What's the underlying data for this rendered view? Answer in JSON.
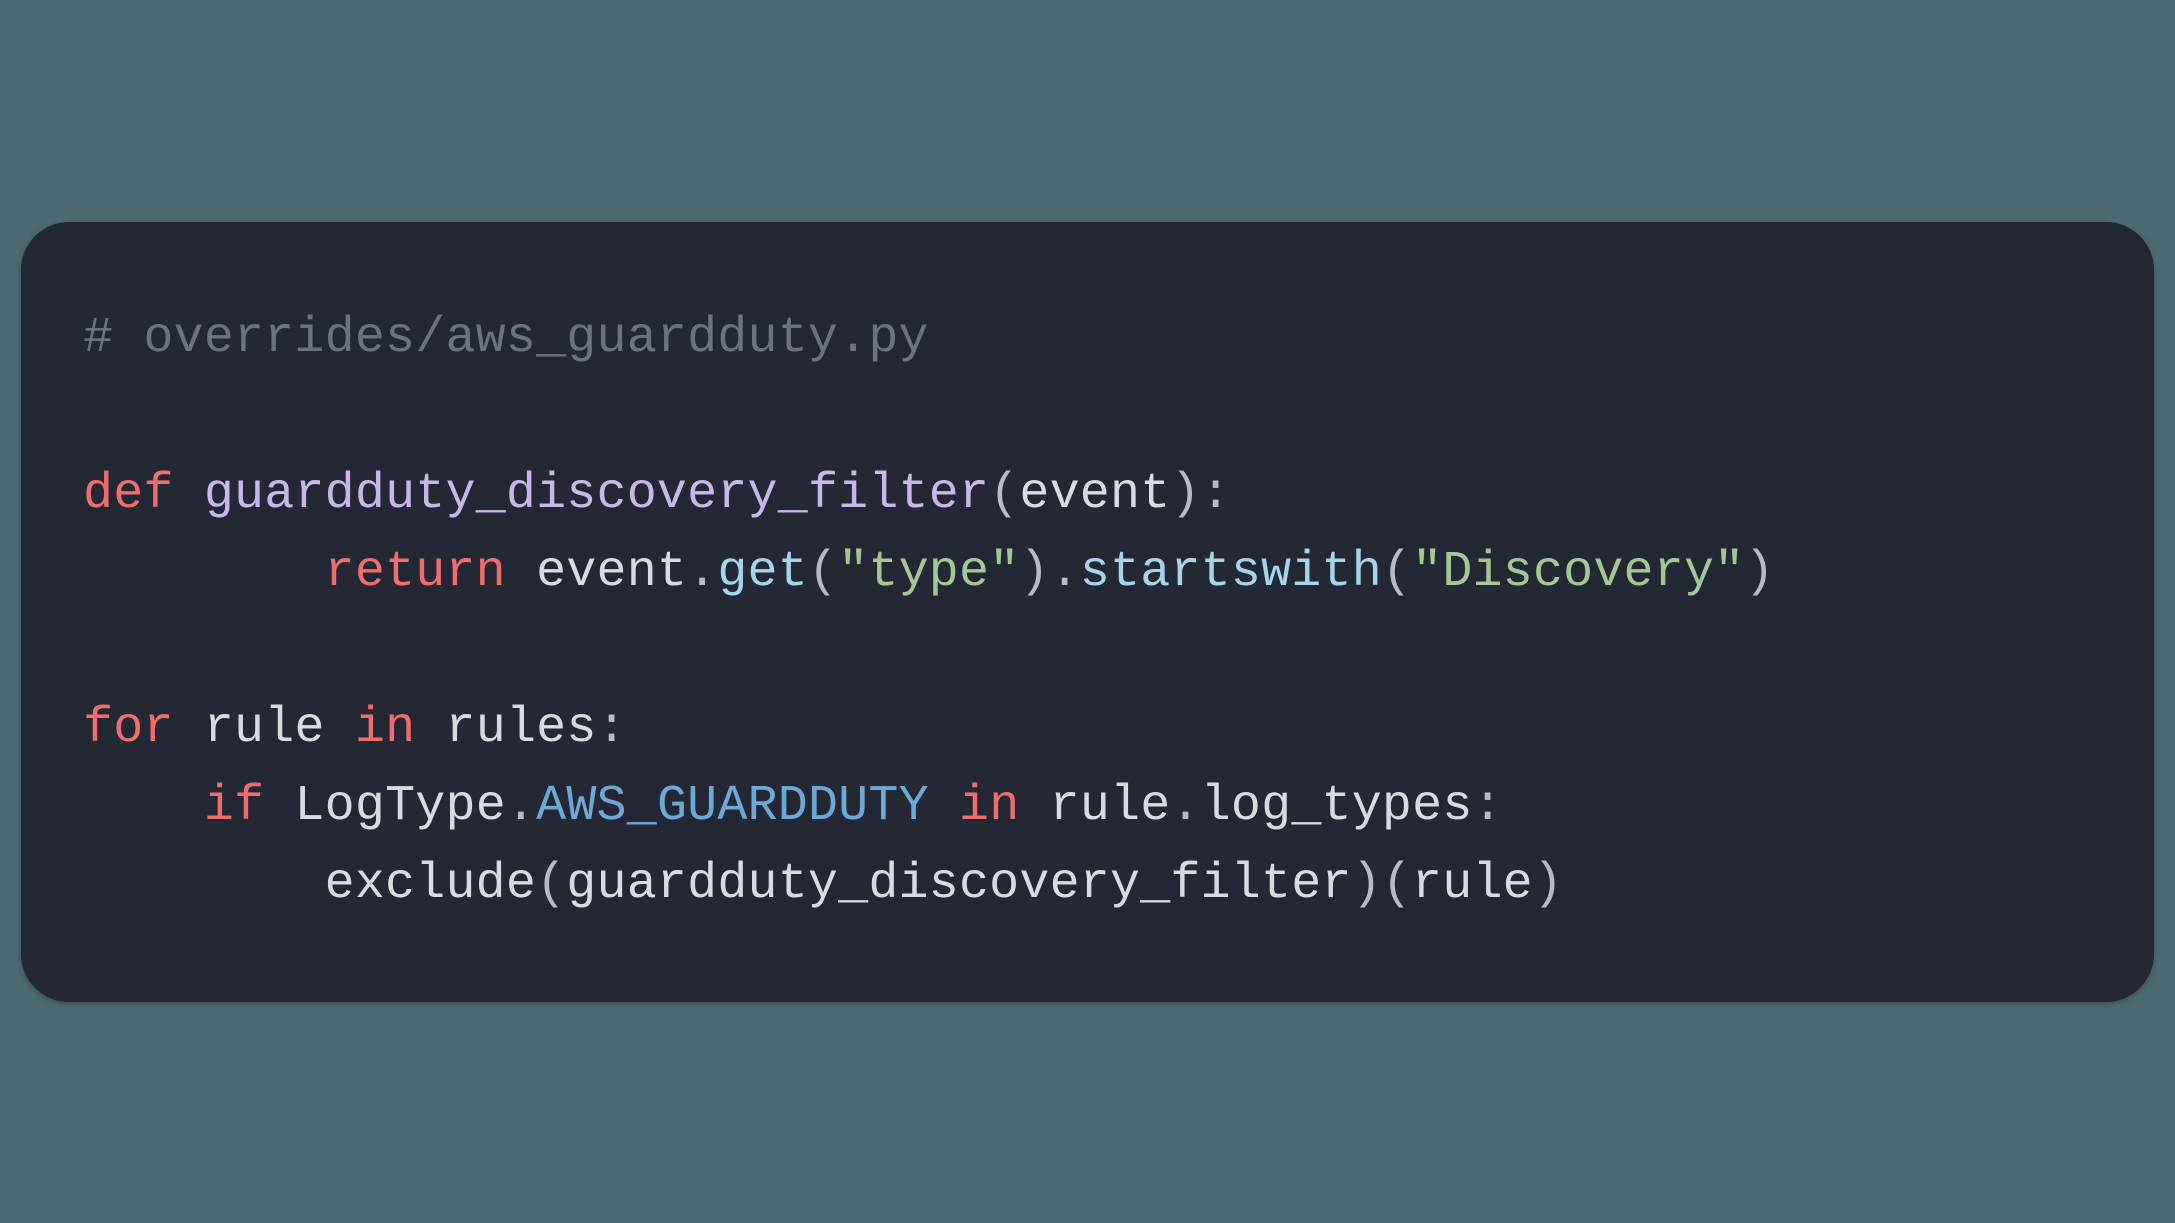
{
  "code": {
    "lines": [
      {
        "tokens": [
          {
            "cls": "tok-comment",
            "text": "# overrides/aws_guardduty.py"
          }
        ]
      },
      {
        "tokens": [
          {
            "cls": "",
            "text": " "
          }
        ]
      },
      {
        "tokens": [
          {
            "cls": "tok-keyword",
            "text": "def"
          },
          {
            "cls": "",
            "text": " "
          },
          {
            "cls": "tok-funcname",
            "text": "guardduty_discovery_filter"
          },
          {
            "cls": "tok-punct",
            "text": "("
          },
          {
            "cls": "tok-ident",
            "text": "event"
          },
          {
            "cls": "tok-punct",
            "text": "):"
          }
        ]
      },
      {
        "tokens": [
          {
            "cls": "",
            "text": "        "
          },
          {
            "cls": "tok-keyword",
            "text": "return"
          },
          {
            "cls": "",
            "text": " "
          },
          {
            "cls": "tok-ident",
            "text": "event"
          },
          {
            "cls": "tok-punct",
            "text": "."
          },
          {
            "cls": "tok-method",
            "text": "get"
          },
          {
            "cls": "tok-punct",
            "text": "("
          },
          {
            "cls": "tok-string",
            "text": "\"type\""
          },
          {
            "cls": "tok-punct",
            "text": ")."
          },
          {
            "cls": "tok-method",
            "text": "startswith"
          },
          {
            "cls": "tok-punct",
            "text": "("
          },
          {
            "cls": "tok-string",
            "text": "\"Discovery\""
          },
          {
            "cls": "tok-punct",
            "text": ")"
          }
        ]
      },
      {
        "tokens": [
          {
            "cls": "",
            "text": " "
          }
        ]
      },
      {
        "tokens": [
          {
            "cls": "tok-keyword",
            "text": "for"
          },
          {
            "cls": "",
            "text": " "
          },
          {
            "cls": "tok-ident",
            "text": "rule"
          },
          {
            "cls": "",
            "text": " "
          },
          {
            "cls": "tok-keyword",
            "text": "in"
          },
          {
            "cls": "",
            "text": " "
          },
          {
            "cls": "tok-ident",
            "text": "rules"
          },
          {
            "cls": "tok-punct",
            "text": ":"
          }
        ]
      },
      {
        "tokens": [
          {
            "cls": "",
            "text": "    "
          },
          {
            "cls": "tok-keyword",
            "text": "if"
          },
          {
            "cls": "",
            "text": " "
          },
          {
            "cls": "tok-ident",
            "text": "LogType"
          },
          {
            "cls": "tok-punct",
            "text": "."
          },
          {
            "cls": "tok-const",
            "text": "AWS_GUARDDUTY"
          },
          {
            "cls": "",
            "text": " "
          },
          {
            "cls": "tok-keyword",
            "text": "in"
          },
          {
            "cls": "",
            "text": " "
          },
          {
            "cls": "tok-ident",
            "text": "rule"
          },
          {
            "cls": "tok-punct",
            "text": "."
          },
          {
            "cls": "tok-ident",
            "text": "log_types"
          },
          {
            "cls": "tok-punct",
            "text": ":"
          }
        ]
      },
      {
        "tokens": [
          {
            "cls": "",
            "text": "        "
          },
          {
            "cls": "tok-ident",
            "text": "exclude"
          },
          {
            "cls": "tok-punct",
            "text": "("
          },
          {
            "cls": "tok-ident",
            "text": "guardduty_discovery_filter"
          },
          {
            "cls": "tok-punct",
            "text": ")("
          },
          {
            "cls": "tok-ident",
            "text": "rule"
          },
          {
            "cls": "tok-punct",
            "text": ")"
          }
        ]
      }
    ]
  }
}
